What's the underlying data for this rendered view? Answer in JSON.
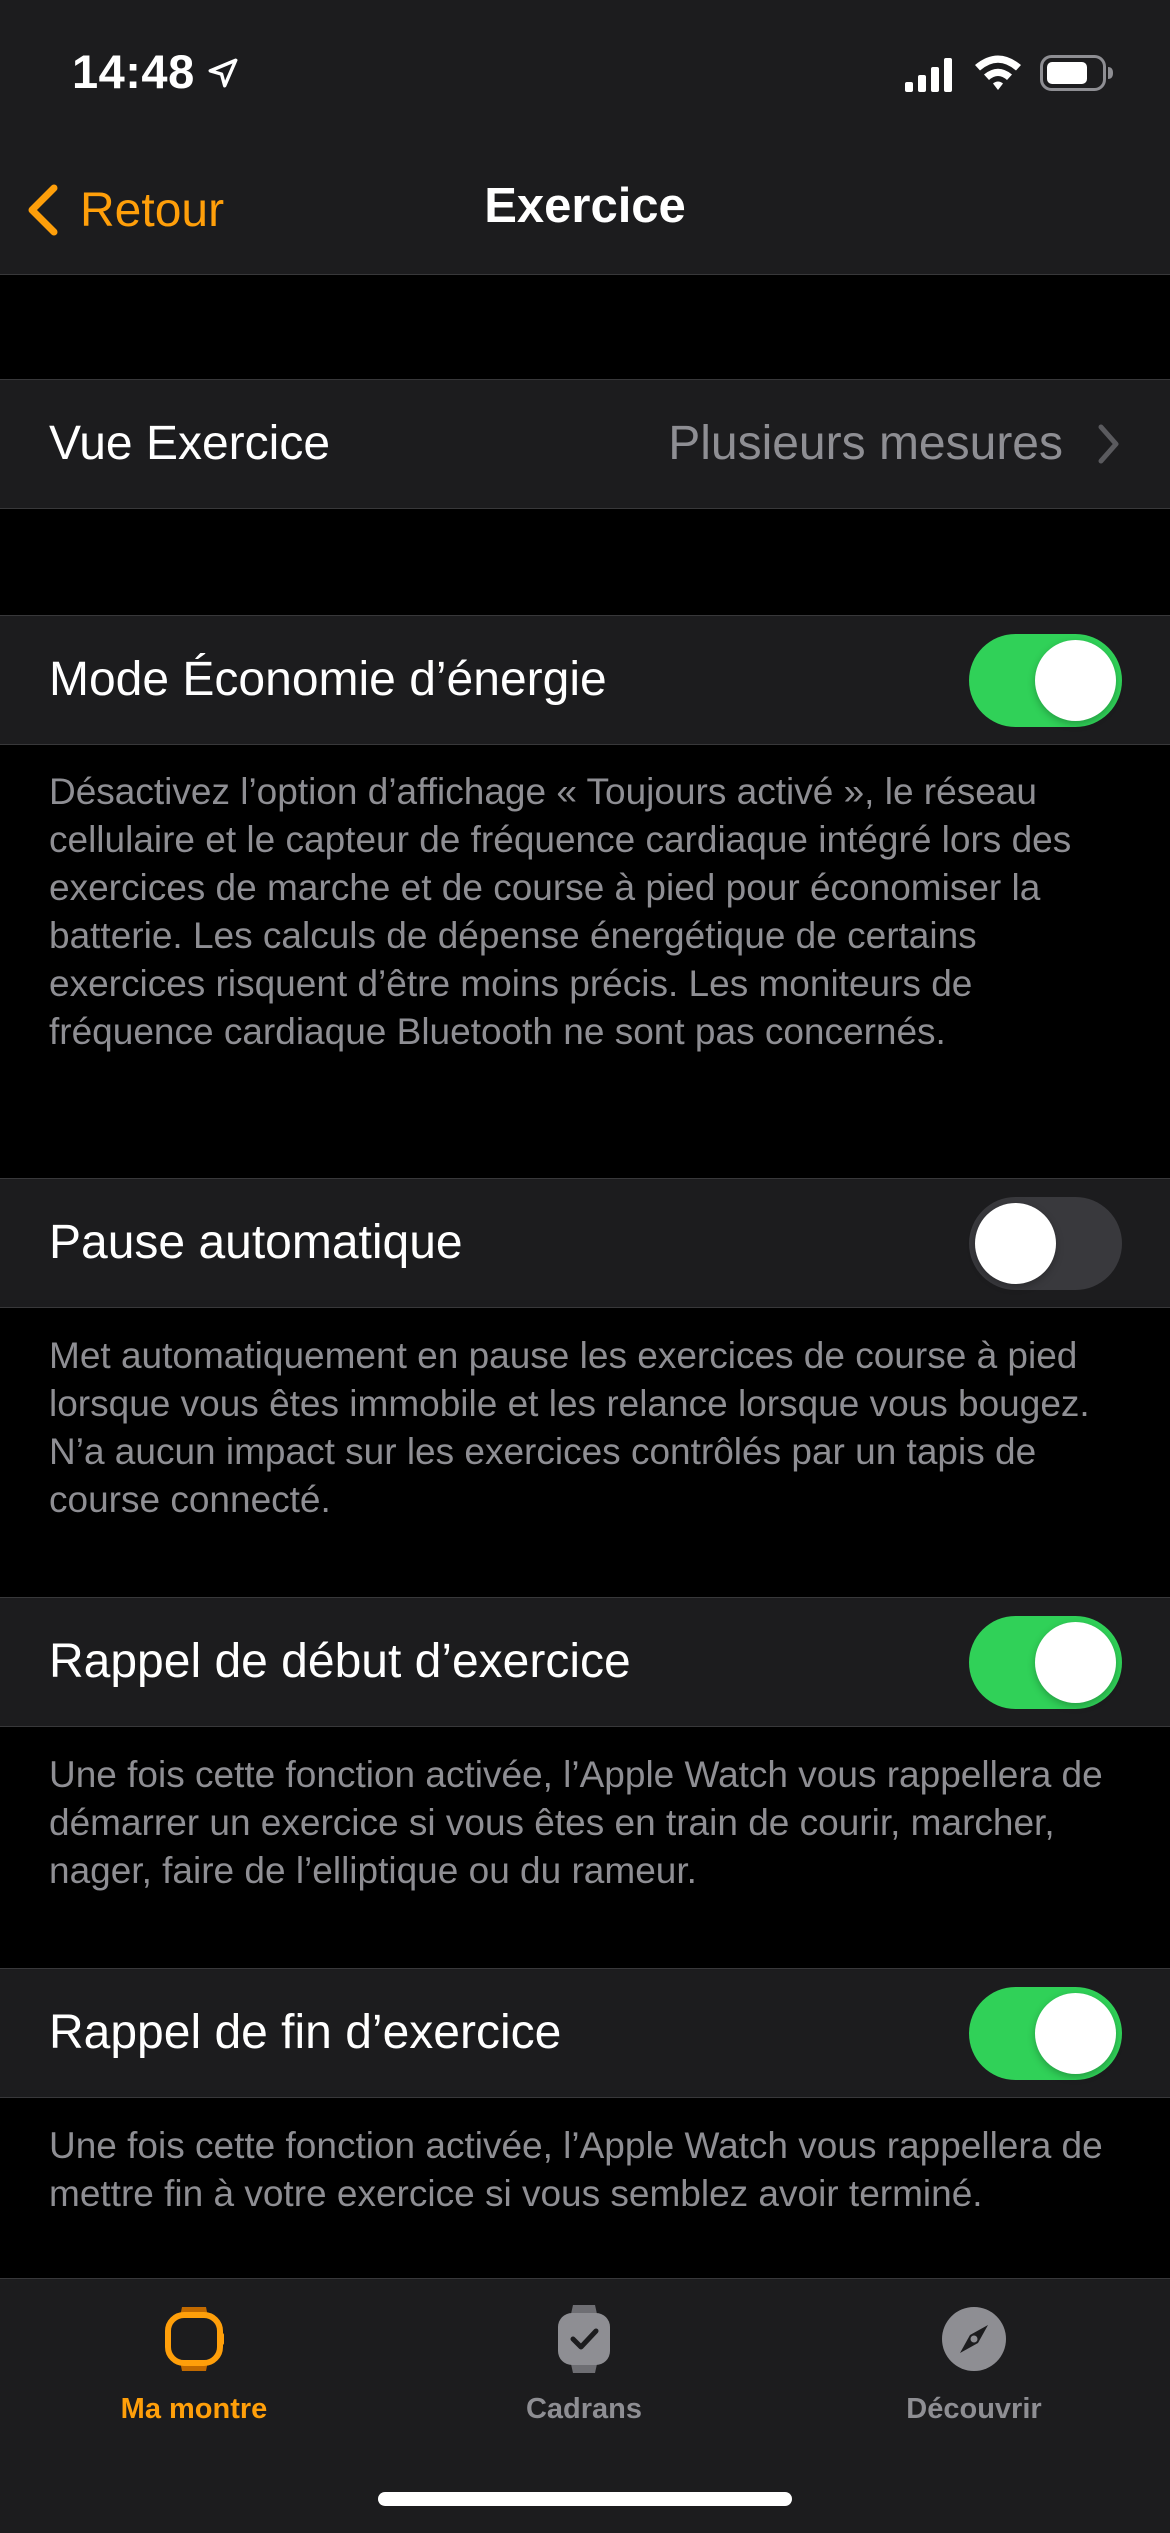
{
  "status_bar": {
    "time": "14:48"
  },
  "nav": {
    "back_label": "Retour",
    "title": "Exercice"
  },
  "view_row": {
    "label": "Vue Exercice",
    "value": "Plusieurs mesures"
  },
  "settings": [
    {
      "label": "Mode Économie d’énergie",
      "enabled": true,
      "footer": "Désactivez l’option d’affichage « Toujours activé », le réseau cellulaire et le capteur de fréquence cardiaque intégré lors des exercices de marche et de course à pied pour économiser la batterie. Les calculs de dépense énergétique de certains exercices risquent d’être moins précis. Les moniteurs de fréquence cardiaque Bluetooth ne sont pas concernés."
    },
    {
      "label": "Pause automatique",
      "enabled": false,
      "footer": "Met automatiquement en pause les exercices de course à pied lorsque vous êtes immobile et les relance lorsque vous bougez. N’a aucun impact sur les exercices contrôlés par un tapis de course connecté."
    },
    {
      "label": "Rappel de début d’exercice",
      "enabled": true,
      "footer": "Une fois cette fonction activée, l’Apple Watch vous rappellera de démarrer un exercice si vous êtes en train de courir, marcher, nager, faire de l’elliptique ou du rameur."
    },
    {
      "label": "Rappel de fin d’exercice",
      "enabled": true,
      "footer": "Une fois cette fonction activée, l’Apple Watch vous rappellera de mettre fin à votre exercice si vous semblez avoir terminé."
    }
  ],
  "tabs": [
    {
      "label": "Ma montre",
      "icon": "watch-icon",
      "active": true
    },
    {
      "label": "Cadrans",
      "icon": "watch-faces-icon",
      "active": false
    },
    {
      "label": "Découvrir",
      "icon": "compass-icon",
      "active": false
    }
  ],
  "colors": {
    "accent": "#ff9f0a",
    "toggle_on": "#30d158",
    "toggle_off": "#39393d",
    "secondary_text": "#8e8e93",
    "cell_background": "#1c1c1e",
    "background": "#000000",
    "inactive_tab": "#8e8e93"
  }
}
